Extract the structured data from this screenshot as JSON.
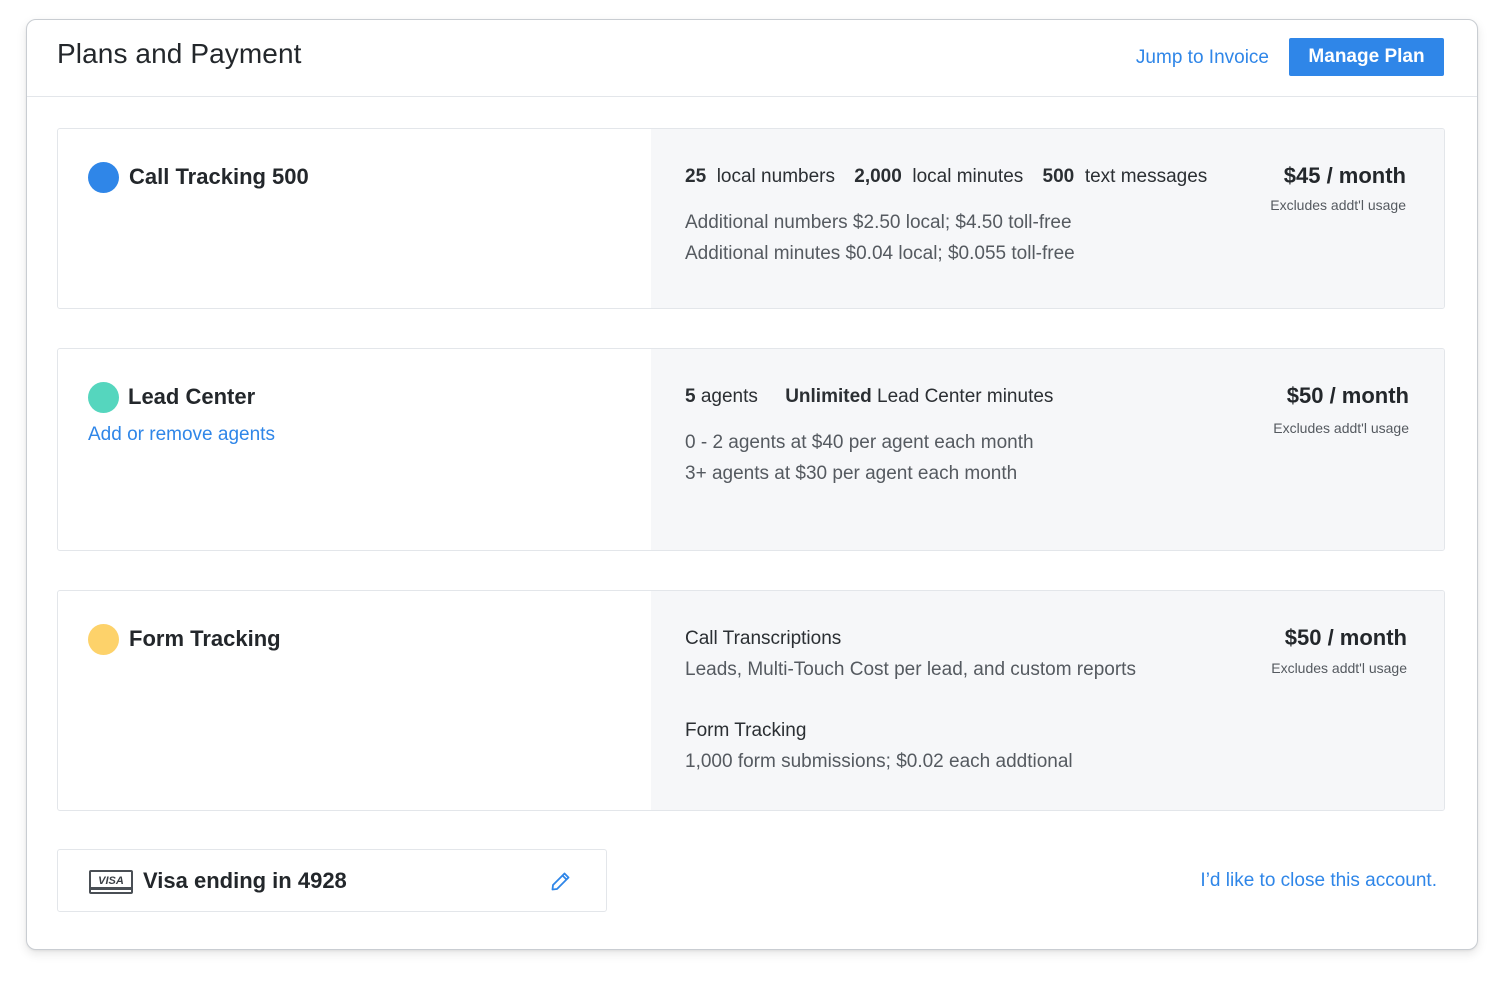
{
  "header": {
    "title": "Plans and Payment",
    "jump_link": "Jump to Invoice",
    "manage_button": "Manage Plan"
  },
  "colors": {
    "accent": "#2f86e8",
    "call_tracking_dot": "#2f86e8",
    "lead_center_dot": "#55d6be",
    "form_tracking_dot": "#fdd26a"
  },
  "plans": [
    {
      "name": "Call Tracking 500",
      "features": [
        {
          "value": "25",
          "label": "local numbers"
        },
        {
          "value": "2,000",
          "label": "local minutes"
        },
        {
          "value": "500",
          "label": "text messages"
        }
      ],
      "details": [
        "Additional numbers $2.50 local; $4.50 toll-free",
        "Additional minutes $0.04 local; $0.055 toll-free"
      ],
      "price": "$45 / month",
      "price_note": "Excludes addt'l usage"
    },
    {
      "name": "Lead Center",
      "link": "Add or remove agents",
      "features": [
        {
          "value": "5",
          "label": "agents"
        },
        {
          "value": "Unlimited",
          "label": "Lead Center minutes"
        }
      ],
      "details": [
        "0 - 2 agents at $40 per agent each month",
        "3+ agents at $30 per agent each month"
      ],
      "price": "$50 / month",
      "price_note": "Excludes addt'l usage"
    },
    {
      "name": "Form Tracking",
      "sections": [
        {
          "title": "Call Transcriptions",
          "desc": "Leads, Multi-Touch Cost per lead, and custom reports"
        },
        {
          "title": "Form Tracking",
          "desc": "1,000 form submissions; $0.02 each addtional"
        }
      ],
      "price": "$50 / month",
      "price_note": "Excludes addt'l usage"
    }
  ],
  "payment": {
    "card_brand": "VISA",
    "card_text": "Visa ending in 4928",
    "edit_icon": "pencil-icon"
  },
  "close_account_link": "I’d like to close this account."
}
